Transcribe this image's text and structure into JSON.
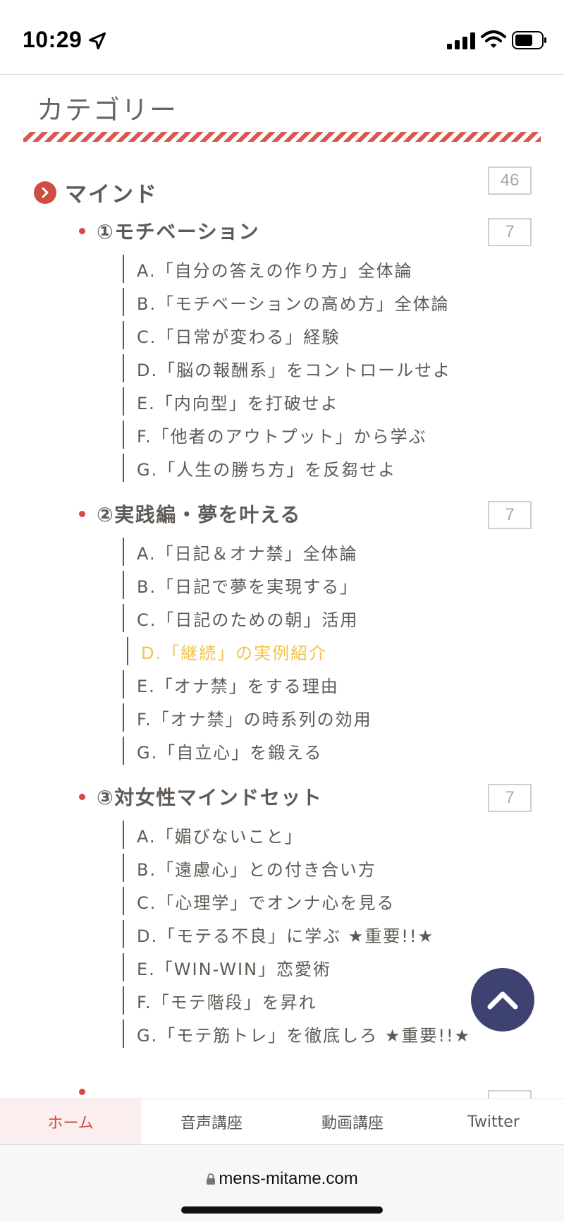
{
  "status_bar": {
    "time": "10:29",
    "icons": [
      "location-arrow-icon",
      "cellular-signal-icon",
      "wifi-icon",
      "battery-icon"
    ]
  },
  "page": {
    "heading": "カテゴリー",
    "accent_color": "#cf4d43",
    "active_item_color": "#f3c24a",
    "categories": [
      {
        "name": "マインド",
        "count": "46",
        "subcategories": [
          {
            "name": "①モチベーション",
            "count": "7",
            "items": [
              "A.「自分の答えの作り方」全体論",
              "B.「モチベーションの高め方」全体論",
              "C.「日常が変わる」経験",
              "D.「脳の報酬系」をコントロールせよ",
              "E.「内向型」を打破せよ",
              "F.「他者のアウトプット」から学ぶ",
              "G.「人生の勝ち方」を反芻せよ"
            ]
          },
          {
            "name": "②実践編・夢を叶える",
            "count": "7",
            "items": [
              "A.「日記＆オナ禁」全体論",
              "B.「日記で夢を実現する」",
              "C.「日記のための朝」活用",
              "D.「継続」の実例紹介",
              "E.「オナ禁」をする理由",
              "F.「オナ禁」の時系列の効用",
              "G.「自立心」を鍛える"
            ]
          },
          {
            "name": "③対女性マインドセット",
            "count": "7",
            "items": [
              "A.「媚びないこと」",
              "B.「遠慮心」との付き合い方",
              "C.「心理学」でオンナ心を見る",
              "D.「モテる不良」に学ぶ ★重要!!★",
              "E.「WIN-WIN」恋愛術",
              "F.「モテ階段」を昇れ",
              "G.「モテ筋トレ」を徹底しろ ★重要!!★"
            ]
          }
        ]
      }
    ]
  },
  "scroll_top_icon": "chevron-up-icon",
  "tabs": [
    "ホーム",
    "音声講座",
    "動画講座",
    "Twitter"
  ],
  "browser": {
    "url": "mens-mitame.com",
    "lock_icon": "lock-icon"
  }
}
